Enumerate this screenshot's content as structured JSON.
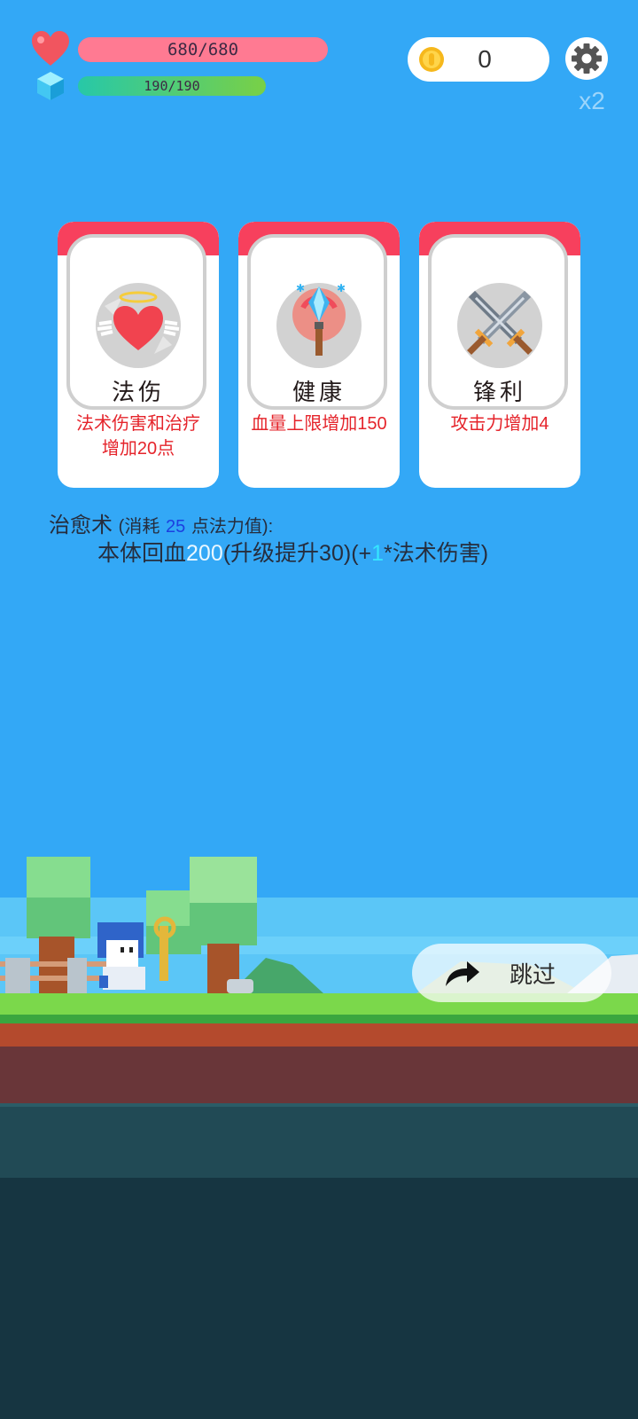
{
  "hud": {
    "hp": {
      "text": "680/680",
      "fraction": 1.0,
      "icon": "heart-icon"
    },
    "mp": {
      "text": "190/190",
      "fraction": 1.0,
      "icon": "crystal-icon"
    },
    "coins": {
      "value": "0",
      "icon": "coin-icon"
    },
    "settings_icon": "gear-icon",
    "speed_label": "x2"
  },
  "cards": [
    {
      "title": "法伤",
      "description": "法术伤害和治疗增加20点",
      "icon": "winged-heart-icon"
    },
    {
      "title": "健康",
      "description": "血量上限增加150",
      "icon": "crystal-staff-icon"
    },
    {
      "title": "锋利",
      "description": "攻击力增加4",
      "icon": "crossed-swords-icon"
    }
  ],
  "skill": {
    "name": "治愈术",
    "cost_prefix": "(消耗",
    "cost_value": "25",
    "cost_suffix": "点法力值):",
    "effect_prefix": "本体回血",
    "effect_value": "200",
    "effect_mid": "(升级提升30)(+",
    "effect_ratio": "1",
    "effect_suffix": "*法术伤害)"
  },
  "skip_button": {
    "label": "跳过",
    "icon": "forward-arrow-icon"
  },
  "colors": {
    "sky": "#33a8f6",
    "card_header": "#f7405d",
    "hp_bar": "#f26585",
    "mp_bar": "#35b9ae",
    "description_red": "#e5242b",
    "grass": "#7bd84b"
  }
}
